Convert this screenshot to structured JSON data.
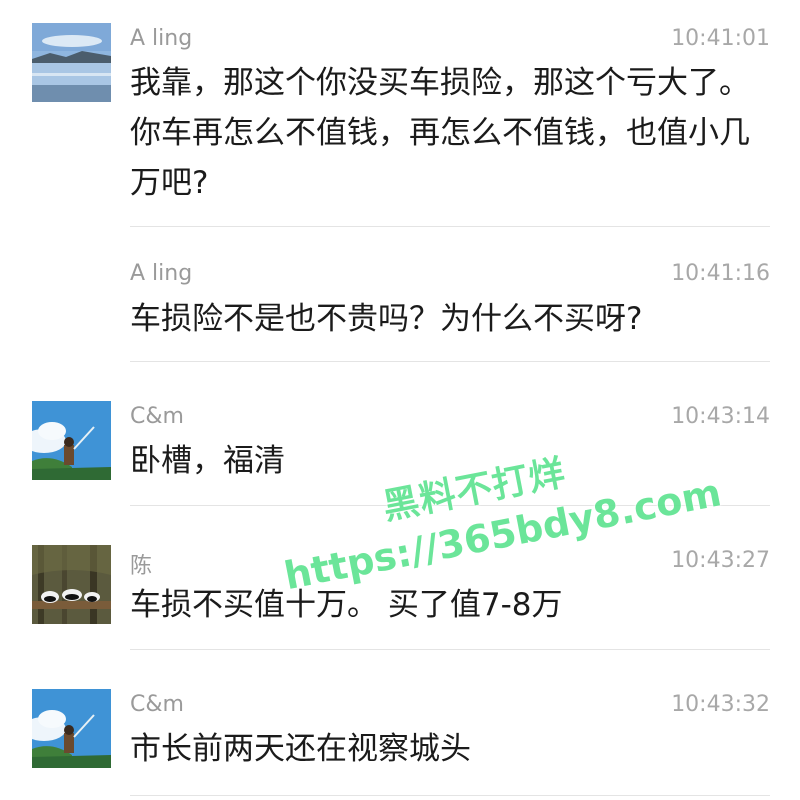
{
  "messages": [
    {
      "sender": "A ling",
      "time": "10:41:01",
      "avatar": "lake-landscape",
      "text": "我靠，那这个你没买车损险，那这个亏大了。你车再怎么不值钱，再怎么不值钱，也值小几万吧?"
    },
    {
      "sender": "A ling",
      "time": "10:41:16",
      "avatar": "",
      "text": "车损险不是也不贵吗？为什么不买呀?"
    },
    {
      "sender": "C&m",
      "time": "10:43:14",
      "avatar": "anime-boy-sky",
      "text": "卧槽，福清"
    },
    {
      "sender": "陈",
      "time": "10:43:27",
      "avatar": "pandas-forest",
      "text": "车损不买值十万。 买了值7-8万"
    },
    {
      "sender": "C&m",
      "time": "10:43:32",
      "avatar": "anime-boy-sky",
      "text": "市长前两天还在视察城头"
    }
  ],
  "watermark": {
    "line1": "黑料不打烊",
    "line2": "https://365bdy8.com"
  }
}
